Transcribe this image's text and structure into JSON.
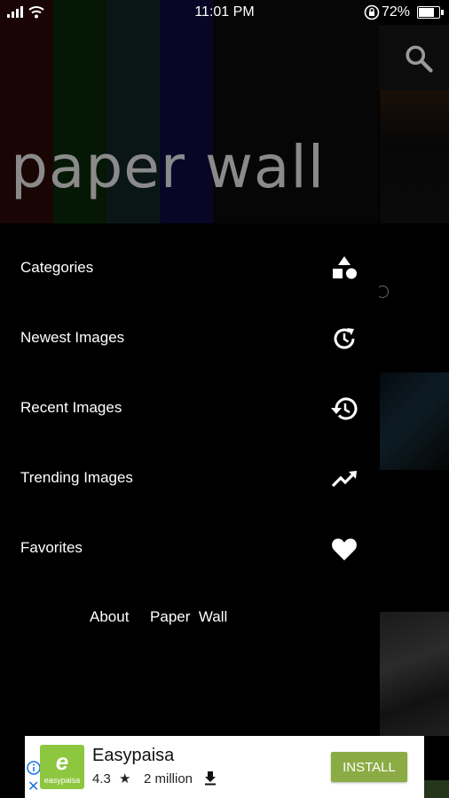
{
  "status_bar": {
    "time": "11:01 PM",
    "battery": "72%",
    "battery_level": 0.72
  },
  "drawer": {
    "logo": "paper wall",
    "items": [
      {
        "label": "Categories",
        "icon": "shapes-icon"
      },
      {
        "label": "Newest Images",
        "icon": "clock-refresh-icon"
      },
      {
        "label": "Recent Images",
        "icon": "history-icon"
      },
      {
        "label": "Trending Images",
        "icon": "trending-up-icon"
      },
      {
        "label": "Favorites",
        "icon": "heart-icon"
      }
    ],
    "about": "About     Paper  Wall"
  },
  "toolbar": {
    "search_icon": "search-icon"
  },
  "ad": {
    "app_name": "Easypaisa",
    "icon_text": "easypaisa",
    "rating": "4.3",
    "downloads": "2 million",
    "install_label": "INSTALL",
    "brand_color": "#8dc63f"
  }
}
